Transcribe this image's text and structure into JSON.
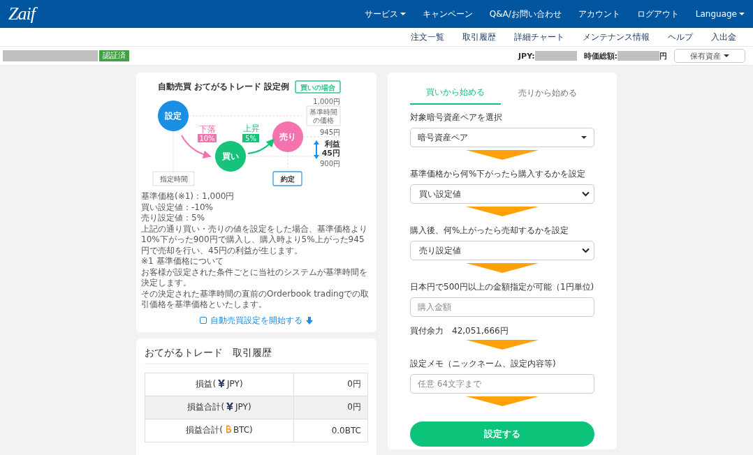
{
  "header": {
    "logo": "Zaif",
    "nav": [
      {
        "label": "サービス",
        "dropdown": true
      },
      {
        "label": "キャンペーン",
        "dropdown": false
      },
      {
        "label": "Q&A/お問い合わせ",
        "dropdown": false
      },
      {
        "label": "アカウント",
        "dropdown": false
      },
      {
        "label": "ログアウト",
        "dropdown": false
      },
      {
        "label": "Language",
        "dropdown": true
      }
    ]
  },
  "subnav": [
    "注文一覧",
    "取引履歴",
    "詳細チャート",
    "メンテナンス情報",
    "ヘルプ",
    "入出金"
  ],
  "account": {
    "verified": "認証済",
    "jpy_label": "JPY:",
    "total_label": "時価総額:",
    "total_unit": "円",
    "assets_button": "保有資産"
  },
  "diagram": {
    "title": "自動売買 おてがるトレード 設定例",
    "badge": "買いの場合",
    "price_top": "1,000円",
    "base_label": [
      "基準時間",
      "の価格"
    ],
    "price_mid": "945円",
    "price_low": "900円",
    "profit": [
      "利益",
      "45円"
    ],
    "time_label": "指定時間",
    "fill_label": "約定",
    "nodes": [
      {
        "label": "設定",
        "color": "#1a8fe3"
      },
      {
        "label": "買い",
        "color": "#17c27a"
      },
      {
        "label": "売り",
        "color": "#f472ad"
      }
    ],
    "moves": [
      {
        "word": "下落",
        "pct": "10%",
        "color": "#f472ad"
      },
      {
        "word": "上昇",
        "pct": "5%",
        "color": "#17c27a"
      }
    ]
  },
  "notes": [
    "基準価格(※1)：1,000円",
    "買い設定値：-10%",
    "売り設定値：5%",
    "上記の通り買い・売りの値を設定をした場合、基準価格より10%下がった900円で購入し、購入時より5%上がった945円で売却を行い、45円の利益が生じます。",
    "※1 基準価格について",
    "お客様が設定された条件ごとに当社のシステムが基準時間を決定します。",
    "その決定された基準時間の直前のOrderbook tradingでの取引価格を基準価格といたします。"
  ],
  "start_link": {
    "label": "自動売買設定を開始する",
    "checked": false
  },
  "history": {
    "title": "おてがるトレード　取引履歴",
    "rows": [
      {
        "prefix": "損益(",
        "kind": "yen",
        "unit": "JPY)",
        "value": "0円",
        "shaded": false
      },
      {
        "prefix": "損益合計(",
        "kind": "yen",
        "unit": "JPY)",
        "value": "0円",
        "shaded": true
      },
      {
        "prefix": "損益合計(",
        "kind": "btc",
        "unit": "BTC)",
        "value": "0.0BTC",
        "shaded": false
      }
    ]
  },
  "form": {
    "tabs": [
      {
        "label": "買いから始める",
        "selected": true
      },
      {
        "label": "売りから始める",
        "selected": false
      }
    ],
    "steps": [
      {
        "label": "対象暗号資産ペアを選択",
        "kind": "dropdown",
        "value": "暗号資産ペア"
      },
      {
        "label": "基準価格から何%下がったら購入するかを設定",
        "kind": "select",
        "value": "買い設定値"
      },
      {
        "label": "購入後、何%上がったら売却するかを設定",
        "kind": "select",
        "value": "売り設定値"
      },
      {
        "label": "日本円で500円以上の金額指定が可能（1円単位)",
        "kind": "input",
        "placeholder": "購入金額",
        "note": "買付余力　42,051,666円"
      },
      {
        "label": "設定メモ（ニックネーム、設定内容等)",
        "kind": "input",
        "placeholder": "任意 64文字まで"
      }
    ],
    "submit": "設定する"
  }
}
